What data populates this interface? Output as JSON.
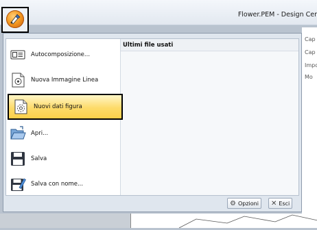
{
  "window": {
    "title": "Flower.PEM - Design Cer"
  },
  "app_button": {
    "icon": "app-menu-orb-icon"
  },
  "background": {
    "captions": [
      "Cap",
      "Cap",
      "Impo",
      "Mo"
    ]
  },
  "menu": {
    "items": [
      {
        "label": "Autocomposizione...",
        "icon": "auto-layout-icon"
      },
      {
        "label": "Nuova Immagine Linea",
        "icon": "new-line-image-icon"
      },
      {
        "label": "Nuovi dati figura",
        "icon": "new-figure-data-icon"
      },
      {
        "label": "Apri...",
        "icon": "open-folder-icon"
      },
      {
        "label": "Salva",
        "icon": "save-icon"
      },
      {
        "label": "Salva con nome...",
        "icon": "save-as-icon"
      }
    ],
    "recent_header": "Ultimi file usati"
  },
  "footer": {
    "options_label": "Opzioni",
    "exit_label": "Esci"
  }
}
